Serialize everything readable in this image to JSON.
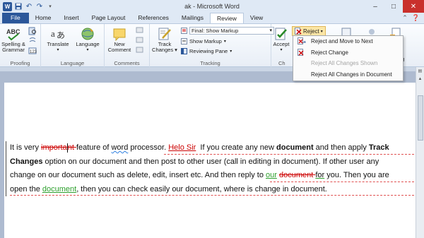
{
  "window": {
    "title": "ak - Microsoft Word",
    "app_icon": "W",
    "qat": {
      "save_icon": "save-icon",
      "undo_icon": "undo-icon",
      "redo_icon": "redo-icon"
    },
    "controls": {
      "minimize": "–",
      "maximize": "□",
      "close": "✕"
    }
  },
  "tabs": [
    {
      "label": "File"
    },
    {
      "label": "Home"
    },
    {
      "label": "Insert"
    },
    {
      "label": "Page Layout"
    },
    {
      "label": "References"
    },
    {
      "label": "Mailings"
    },
    {
      "label": "Review"
    },
    {
      "label": "View"
    }
  ],
  "ribbon": {
    "proofing": {
      "label": "Proofing",
      "spelling": "Spelling &",
      "grammar": "Grammar"
    },
    "language": {
      "label": "Language",
      "translate": "Translate",
      "language": "Language"
    },
    "comments": {
      "label": "Comments",
      "new_comment_1": "New",
      "new_comment_2": "Comment"
    },
    "tracking": {
      "label": "Tracking",
      "track_changes_1": "Track",
      "track_changes_2": "Changes",
      "markup_dropdown": "Final: Show Markup",
      "show_markup": "Show Markup",
      "reviewing_pane": "Reviewing Pane"
    },
    "changes": {
      "label": "Ch",
      "accept": "Accept",
      "reject": "Reject"
    },
    "right_partial": {
      "label_a": "t",
      "label_b": "g"
    }
  },
  "reject_menu": {
    "items": [
      {
        "label": "Reject and Move to Next",
        "enabled": true
      },
      {
        "label": "Reject Change",
        "enabled": true
      },
      {
        "label": "Reject All Changes Shown",
        "enabled": false
      },
      {
        "label": "Reject All Changes in Document",
        "enabled": true
      }
    ]
  },
  "document": {
    "line1": {
      "a": "It is very ",
      "deleted1": "importa",
      "deleted2": "nt ",
      "b": "feature of ",
      "word": "word",
      "c": " processor. ",
      "inserted": "Helo Sir",
      "d": "  If you create any new ",
      "bold1": "document",
      "e": " and then apply ",
      "bold2": "Track"
    },
    "line2": {
      "bold": "Changes",
      "text": " option on our document and then post to other user (call in editing in document). If other user any"
    },
    "line3": {
      "a": "change on our document such as delete, edit, insert etc. And then reply to ",
      "our": "our",
      "space": " ",
      "deleted": "document ",
      "for": "for",
      "b": " you. Then you are"
    },
    "line4": {
      "a": "open the ",
      "doc": "document",
      "b": ", then you can check easily our document, where is change in document."
    }
  }
}
